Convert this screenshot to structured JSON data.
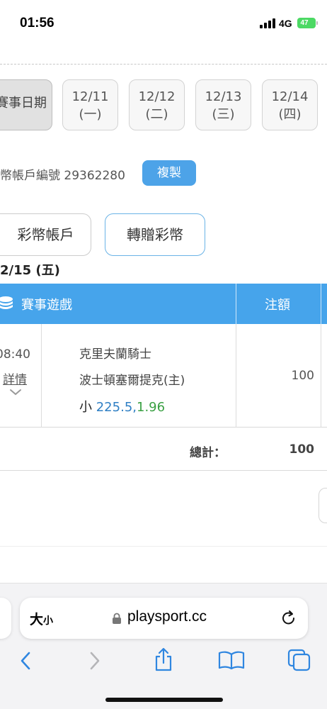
{
  "status": {
    "time": "01:56",
    "network": "4G",
    "battery": "47"
  },
  "date_tabs": [
    {
      "label": "賽事日期",
      "active": true
    },
    {
      "line1": "12/11",
      "line2": "(一)"
    },
    {
      "line1": "12/12",
      "line2": "(二)"
    },
    {
      "line1": "12/13",
      "line2": "(三)"
    },
    {
      "line1": "12/14",
      "line2": "(四)"
    }
  ],
  "account": {
    "label": "彩幣帳戶編號",
    "number": "29362280",
    "copy_label": "複製"
  },
  "actions": {
    "wallet": "彩幣帳戶",
    "transfer": "轉贈彩幣"
  },
  "day_label": "2/15 (五)",
  "table": {
    "headers": {
      "game": "賽事遊戲",
      "amount": "注額"
    },
    "rows": [
      {
        "time": "08:40",
        "detail": "詳情",
        "away": "克里夫蘭騎士",
        "home": "波士頓塞爾提克(主)",
        "bet_side": "小",
        "bet_line": "225.5,",
        "bet_odds": "1.96",
        "amount": "100"
      }
    ],
    "total_label": "總計：",
    "total_value": "100"
  },
  "browser": {
    "text_size": "大",
    "text_size_small": "小",
    "url": "playsport.cc"
  },
  "colors": {
    "accent": "#46a4eb",
    "line_blue": "#2f7fc4",
    "odds_green": "#3aa043"
  }
}
